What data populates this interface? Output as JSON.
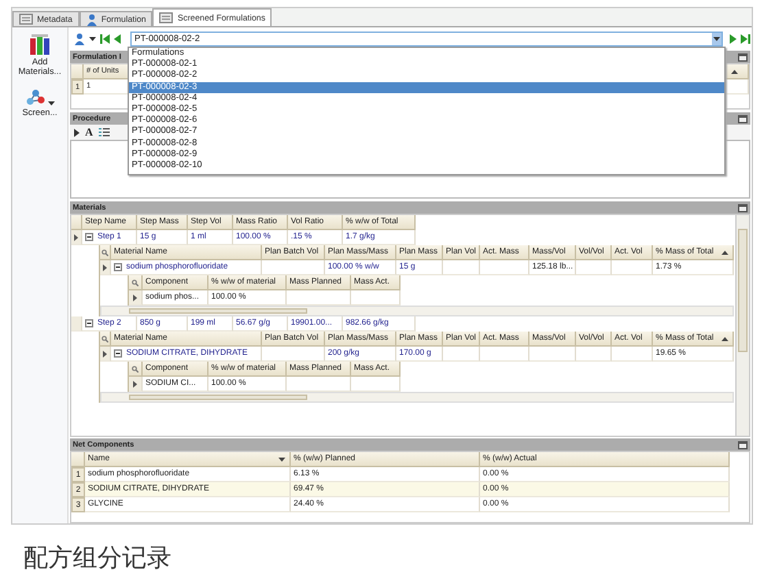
{
  "tabs": [
    {
      "label": "Metadata",
      "selected": false
    },
    {
      "label": "Formulation",
      "selected": false
    },
    {
      "label": "Screened Formulations",
      "selected": true
    }
  ],
  "ribbon": [
    {
      "kind": "add",
      "label": "Add Materials..."
    },
    {
      "kind": "screen",
      "label": "Screen..."
    }
  ],
  "formulation_selector": {
    "value": "PT-000008-02-2",
    "dropdown": {
      "header": "Formulations",
      "items": [
        {
          "label": "PT-000008-02-1",
          "selected": false
        },
        {
          "label": "PT-000008-02-2",
          "selected": false
        },
        {
          "label": "PT-000008-02-3",
          "selected": true
        },
        {
          "label": "PT-000008-02-4",
          "selected": false
        },
        {
          "label": "PT-000008-02-5",
          "selected": false
        },
        {
          "label": "PT-000008-02-6",
          "selected": false
        },
        {
          "label": "PT-000008-02-7",
          "selected": false
        },
        {
          "label": "PT-000008-02-8",
          "selected": false
        },
        {
          "label": "PT-000008-02-9",
          "selected": false
        },
        {
          "label": "PT-000008-02-10",
          "selected": false
        }
      ]
    }
  },
  "formulation_panel": {
    "title": "Formulation I",
    "columns": [
      {
        "label": "# of Units"
      },
      {
        "sorted_ascending": true
      }
    ],
    "rows": [
      {
        "number": "1",
        "cells": [
          "1",
          null
        ]
      }
    ]
  },
  "procedure": {
    "title": "Procedure",
    "font_button": "A"
  },
  "materials": {
    "title": "Materials",
    "columns": [
      {
        "label": "Step Name"
      },
      {
        "label": "Step Mass"
      },
      {
        "label": "Step Vol"
      },
      {
        "label": "Mass Ratio"
      },
      {
        "label": "Vol Ratio"
      },
      {
        "label": "% w/w of Total"
      }
    ],
    "steps": [
      {
        "current": true,
        "expanded": true,
        "cells": [
          "Step 1",
          "15 g",
          "1 ml",
          "100.00 %",
          ".15 %",
          "1.7 g/kg"
        ],
        "material_grid": {
          "columns": [
            {
              "label": "Material Name"
            },
            {
              "label": "Plan Batch Vol"
            },
            {
              "label": "Plan Mass/Mass"
            },
            {
              "label": "Plan Mass"
            },
            {
              "label": "Plan Vol"
            },
            {
              "label": "Act. Mass"
            },
            {
              "label": "Mass/Vol"
            },
            {
              "label": "Vol/Vol"
            },
            {
              "label": "Act. Vol"
            },
            {
              "label": "% Mass of Total",
              "sorted_ascending": true
            }
          ],
          "rows": [
            {
              "current": true,
              "expanded": true,
              "cells": [
                "sodium phosphorofluoridate",
                null,
                "100.00 % w/w",
                "15 g",
                null,
                null,
                "125.18 lb...",
                null,
                null,
                "1.73 %"
              ],
              "component_grid": {
                "columns": [
                  {
                    "label": "Component"
                  },
                  {
                    "label": "% w/w of material"
                  },
                  {
                    "label": "Mass Planned"
                  },
                  {
                    "label": "Mass Act."
                  }
                ],
                "rows": [
                  {
                    "current": true,
                    "cells": [
                      "sodium phos...",
                      "100.00 %",
                      null,
                      null
                    ]
                  }
                ]
              }
            }
          ]
        }
      },
      {
        "current": false,
        "expanded": true,
        "cells": [
          "Step 2",
          "850 g",
          "199 ml",
          "56.67 g/g",
          "19901.00...",
          "982.66 g/kg"
        ],
        "material_grid": {
          "columns": [
            {
              "label": "Material Name"
            },
            {
              "label": "Plan Batch Vol"
            },
            {
              "label": "Plan Mass/Mass"
            },
            {
              "label": "Plan Mass"
            },
            {
              "label": "Plan Vol"
            },
            {
              "label": "Act. Mass"
            },
            {
              "label": "Mass/Vol"
            },
            {
              "label": "Vol/Vol"
            },
            {
              "label": "Act. Vol"
            },
            {
              "label": "% Mass of Total",
              "sorted_ascending": true
            }
          ],
          "rows": [
            {
              "current": true,
              "expanded": true,
              "cells": [
                "SODIUM CITRATE, DIHYDRATE",
                null,
                "200 g/kg",
                "170.00 g",
                null,
                null,
                null,
                null,
                null,
                "19.65 %"
              ],
              "component_grid": {
                "columns": [
                  {
                    "label": "Component"
                  },
                  {
                    "label": "% w/w of material"
                  },
                  {
                    "label": "Mass Planned"
                  },
                  {
                    "label": "Mass Act."
                  }
                ],
                "rows": [
                  {
                    "current": true,
                    "cells": [
                      "SODIUM CI...",
                      "100.00 %",
                      null,
                      null
                    ]
                  }
                ]
              }
            }
          ]
        }
      }
    ]
  },
  "net_components": {
    "title": "Net Components",
    "columns": [
      {
        "label": "Name",
        "sorted_descending": true
      },
      {
        "label": "% (w/w) Planned"
      },
      {
        "label": "% (w/w) Actual"
      }
    ],
    "rows": [
      {
        "number": "1",
        "cells": [
          "sodium phosphorofluoridate",
          "6.13 %",
          "0.00 %"
        ]
      },
      {
        "number": "2",
        "cells": [
          "SODIUM CITRATE, DIHYDRATE",
          "69.47 %",
          "0.00 %"
        ]
      },
      {
        "number": "3",
        "cells": [
          "GLYCINE",
          "24.40 %",
          "0.00 %"
        ]
      }
    ]
  },
  "caption": "配方组分记录"
}
